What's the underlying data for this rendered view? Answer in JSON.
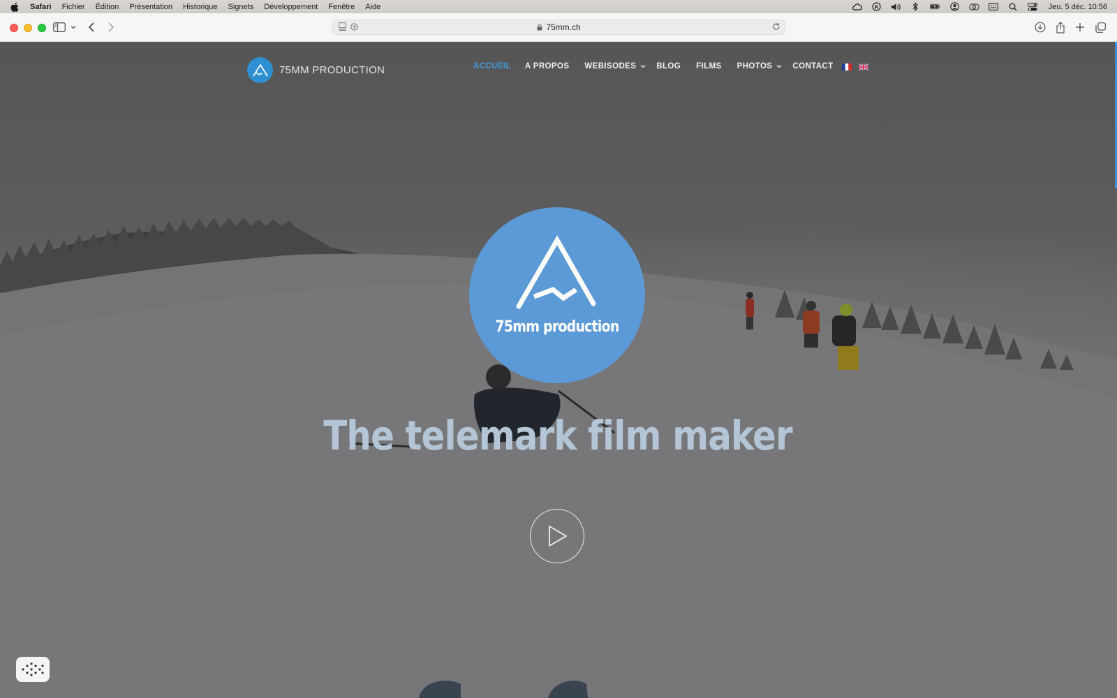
{
  "menubar": {
    "app": "Safari",
    "items": [
      "Fichier",
      "Édition",
      "Présentation",
      "Historique",
      "Signets",
      "Développement",
      "Fenêtre",
      "Aide"
    ],
    "clock": "Jeu. 5 déc.  10:56"
  },
  "browser": {
    "url": "75mm.ch"
  },
  "site": {
    "brand_name": "75MM PRODUCTION",
    "nav": [
      {
        "label": "ACCUEIL",
        "active": true
      },
      {
        "label": "A PROPOS"
      },
      {
        "label": "WEBISODES",
        "dropdown": true
      },
      {
        "label": "BLOG"
      },
      {
        "label": "FILMS"
      },
      {
        "label": "PHOTOS",
        "dropdown": true
      },
      {
        "label": "CONTACT"
      }
    ],
    "languages": [
      "fr-flag-icon",
      "uk-flag-icon"
    ],
    "accent_color": "#3d9be0"
  },
  "hero": {
    "logo_text": "75mm production",
    "tagline": "The telemark film maker",
    "logo_color": "#5c9ad7"
  }
}
